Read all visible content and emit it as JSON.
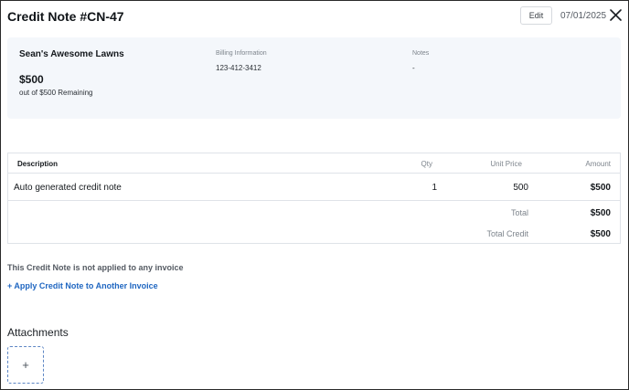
{
  "header": {
    "title": "Credit Note #CN-47",
    "edit_label": "Edit",
    "date": "07/01/2025",
    "close_icon": "close-icon"
  },
  "summary": {
    "customer_name": "Sean's Awesome Lawns",
    "amount": "$500",
    "remaining": "out of $500 Remaining",
    "billing_label": "Billing Information",
    "billing_value": "123-412-3412",
    "notes_label": "Notes",
    "notes_value": "-"
  },
  "table": {
    "headers": {
      "description": "Description",
      "qty": "Qty",
      "unit_price": "Unit Price",
      "amount": "Amount"
    },
    "rows": [
      {
        "description": "Auto generated credit note",
        "qty": "1",
        "unit_price": "500",
        "amount": "$500"
      }
    ],
    "total_label": "Total",
    "total_value": "$500",
    "total_credit_label": "Total Credit",
    "total_credit_value": "$500"
  },
  "application": {
    "status": "This Credit Note is not applied to any invoice",
    "apply_link": "+ Apply Credit Note to Another Invoice"
  },
  "attachments": {
    "title": "Attachments",
    "add_symbol": "+"
  },
  "colors": {
    "accent": "#1f66c1",
    "summary_bg": "#f4f7fb"
  }
}
